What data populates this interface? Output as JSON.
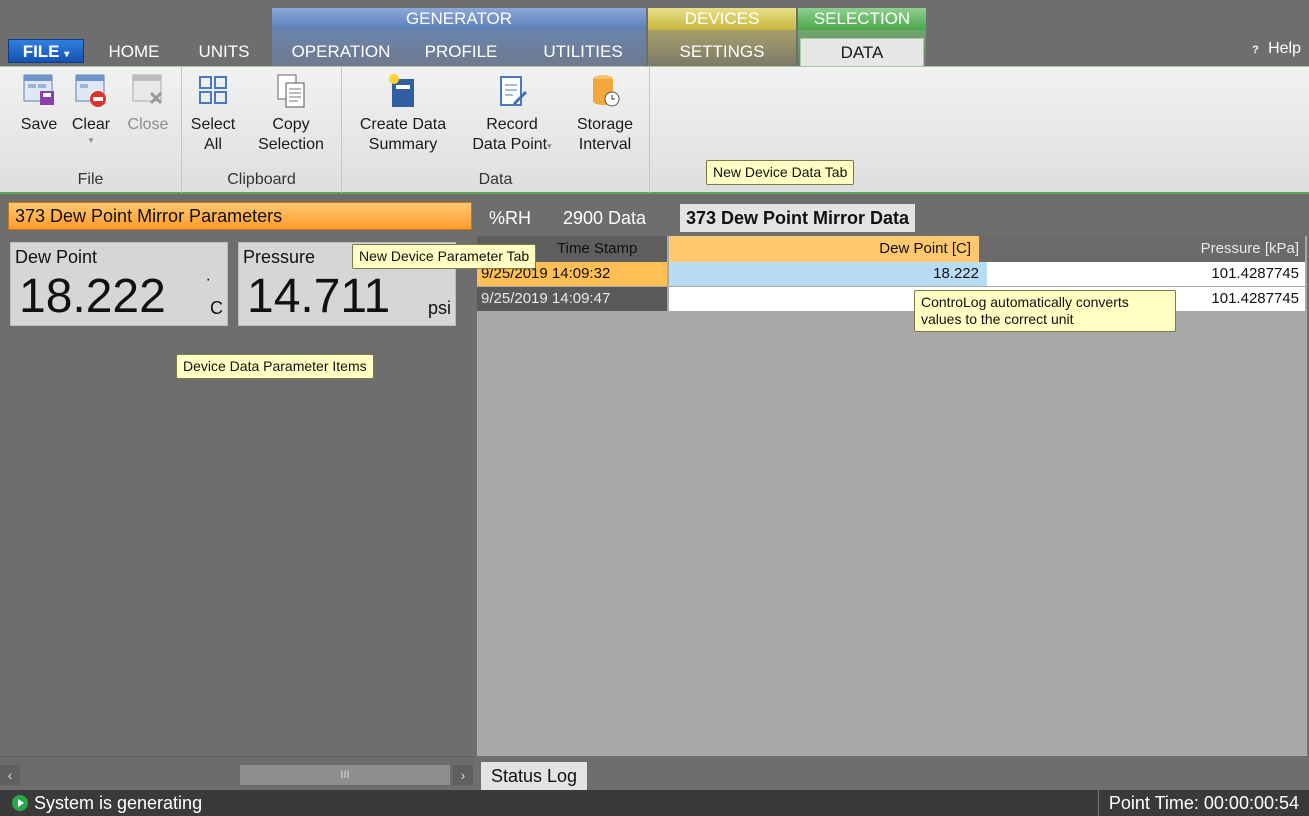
{
  "ribbon_tabs": {
    "file": "FILE",
    "home": "HOME",
    "units": "UNITS",
    "generator_group": "GENERATOR",
    "operation": "OPERATION",
    "profile": "PROFILE",
    "utilities": "UTILITIES",
    "devices_group": "DEVICES",
    "settings": "SETTINGS",
    "selection_group": "SELECTION",
    "data": "DATA",
    "help": "Help"
  },
  "ribbon": {
    "file_group": {
      "label": "File",
      "save": "Save",
      "clear": "Clear",
      "close": "Close"
    },
    "clipboard_group": {
      "label": "Clipboard",
      "select_all_1": "Select",
      "select_all_2": "All",
      "copy_1": "Copy",
      "copy_2": "Selection"
    },
    "data_group": {
      "label": "Data",
      "create_1": "Create Data",
      "create_2": "Summary",
      "record_1": "Record",
      "record_2": "Data Point",
      "storage_1": "Storage",
      "storage_2": "Interval"
    }
  },
  "left_panel": {
    "header": "373 Dew Point Mirror Parameters",
    "params": [
      {
        "name": "Dew Point",
        "value": "18.222",
        "unit": "C",
        "superscript": "·"
      },
      {
        "name": "Pressure",
        "value": "14.711",
        "unit": "psi"
      }
    ]
  },
  "right_panel": {
    "tabs": [
      "%RH",
      "2900 Data",
      "373 Dew Point Mirror Data"
    ],
    "columns": [
      "Time Stamp",
      "Dew Point [C]",
      "Pressure [kPa]"
    ],
    "rows": [
      {
        "time": "9/25/2019 14:09:32",
        "dew": "18.222",
        "pressure": "101.4287745"
      },
      {
        "time": "9/25/2019 14:09:47",
        "dew": "",
        "pressure": "101.4287745"
      }
    ],
    "status_log_tab": "Status Log"
  },
  "callouts": {
    "data_tab": "New Device Data Tab",
    "param_tab": "New Device Parameter Tab",
    "param_items": "Device Data Parameter Items",
    "convert": "ControLog automatically converts values to the correct unit"
  },
  "statusbar": {
    "status": "System is generating",
    "point_time": "Point Time: 00:00:00:54"
  },
  "colors": {
    "accent_blue": "#1652b0",
    "selection_green": "#4aa64a",
    "param_header_orange": "#ff9c2a",
    "status_green": "#27a84a"
  }
}
